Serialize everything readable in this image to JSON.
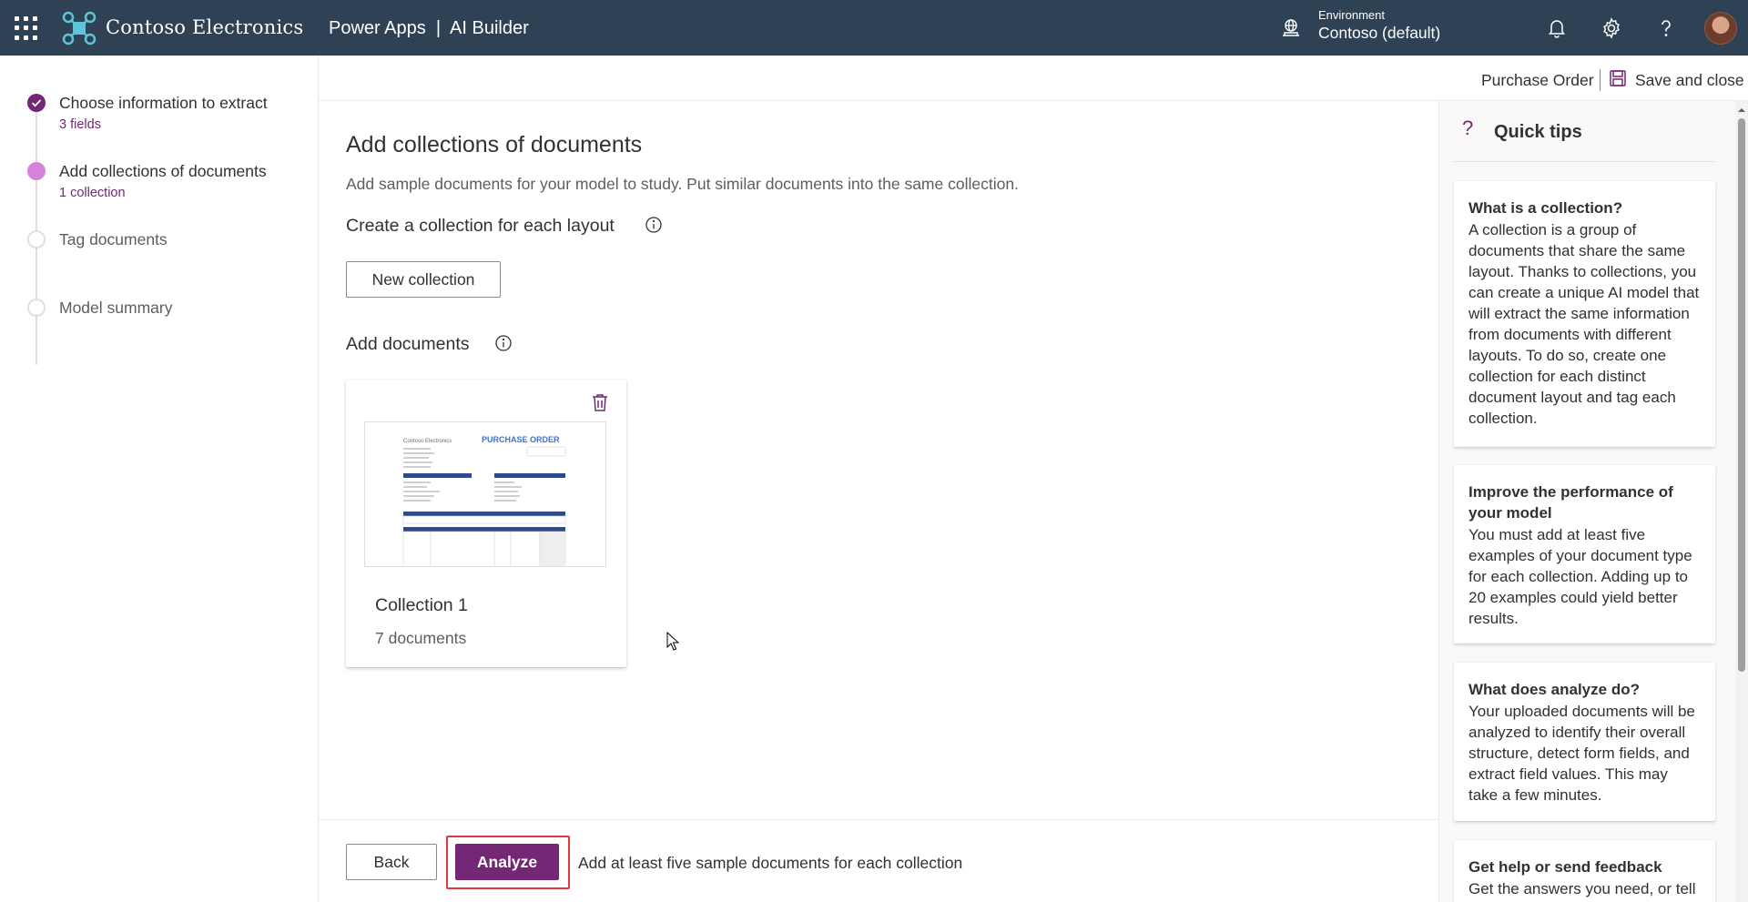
{
  "topbar": {
    "brand_name": "Contoso Electronics",
    "app_title": "Power Apps  |  AI Builder",
    "environment_label": "Environment",
    "environment_value": "Contoso (default)",
    "icons": [
      "waffle-icon",
      "environment-icon",
      "bell-icon",
      "gear-icon",
      "help-icon"
    ]
  },
  "steps": [
    {
      "title": "Choose information to extract",
      "sub": "3 fields",
      "state": "done"
    },
    {
      "title": "Add collections of documents",
      "sub": "1 collection",
      "state": "current"
    },
    {
      "title": "Tag documents",
      "sub": "",
      "state": "todo"
    },
    {
      "title": "Model summary",
      "sub": "",
      "state": "todo"
    }
  ],
  "commands": {
    "model_name": "Purchase Order",
    "save_close": "Save and close"
  },
  "main": {
    "title": "Add collections of documents",
    "description": "Add sample documents for your model to study. Put similar documents into the same collection.",
    "create_heading": "Create a collection for each layout",
    "new_collection_label": "New collection",
    "add_docs_heading": "Add documents",
    "collection": {
      "name": "Collection 1",
      "count": "7 documents",
      "thumb_company": "Contoso Electronics",
      "thumb_heading": "PURCHASE ORDER"
    }
  },
  "footer": {
    "back_label": "Back",
    "analyze_label": "Analyze",
    "hint": "Add at least five sample documents for each collection"
  },
  "tips": {
    "title": "Quick tips",
    "cards": [
      {
        "heading": "What is a collection?",
        "body": "A collection is a group of documents that share the same layout. Thanks to collections, you can create a unique AI model that will extract the same information from documents with different layouts. To do so, create one collection for each distinct document layout and tag each collection."
      },
      {
        "heading": "Improve the performance of your model",
        "body": "You must add at least five examples of your document type for each collection. Adding up to 20 examples could yield better results."
      },
      {
        "heading": "What does analyze do?",
        "body": "Your uploaded documents will be analyzed to identify their overall structure, detect form fields, and extract field values. This may take a few minutes."
      },
      {
        "heading": "Get help or send feedback",
        "body": "Get the answers you need, or tell"
      }
    ]
  },
  "colors": {
    "topbar": "#2f4154",
    "accent": "#742774",
    "current_step": "#d584d9",
    "highlight": "#e0393e"
  }
}
